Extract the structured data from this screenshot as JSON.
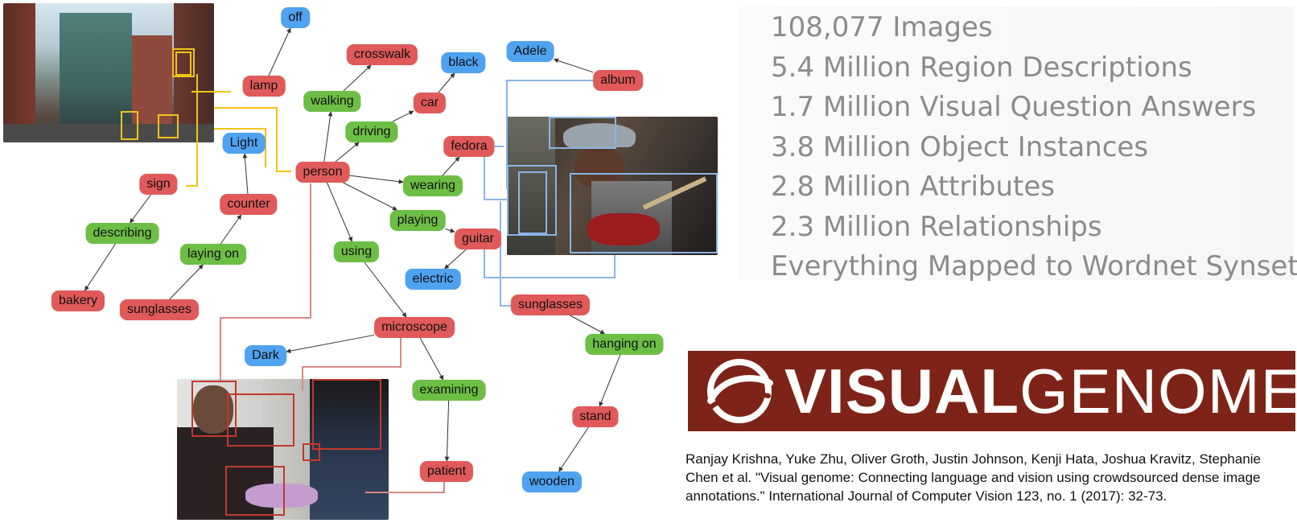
{
  "nodes": {
    "off": {
      "label": "off",
      "kind": "att"
    },
    "lamp": {
      "label": "lamp",
      "kind": "obj"
    },
    "crosswalk": {
      "label": "crosswalk",
      "kind": "obj"
    },
    "black": {
      "label": "black",
      "kind": "att"
    },
    "adele": {
      "label": "Adele",
      "kind": "att"
    },
    "album": {
      "label": "album",
      "kind": "obj"
    },
    "walking": {
      "label": "walking",
      "kind": "rel"
    },
    "car": {
      "label": "car",
      "kind": "obj"
    },
    "driving": {
      "label": "driving",
      "kind": "rel"
    },
    "fedora": {
      "label": "fedora",
      "kind": "obj"
    },
    "light": {
      "label": "Light",
      "kind": "att"
    },
    "person": {
      "label": "person",
      "kind": "obj"
    },
    "sign": {
      "label": "sign",
      "kind": "obj"
    },
    "wearing": {
      "label": "wearing",
      "kind": "rel"
    },
    "counter": {
      "label": "counter",
      "kind": "obj"
    },
    "playing": {
      "label": "playing",
      "kind": "rel"
    },
    "describing": {
      "label": "describing",
      "kind": "rel"
    },
    "guitar": {
      "label": "guitar",
      "kind": "obj"
    },
    "laying_on": {
      "label": "laying on",
      "kind": "rel"
    },
    "using": {
      "label": "using",
      "kind": "rel"
    },
    "electric": {
      "label": "electric",
      "kind": "att"
    },
    "bakery": {
      "label": "bakery",
      "kind": "obj"
    },
    "sunglasses1": {
      "label": "sunglasses",
      "kind": "obj"
    },
    "sunglasses2": {
      "label": "sunglasses",
      "kind": "obj"
    },
    "microscope": {
      "label": "microscope",
      "kind": "obj"
    },
    "hanging_on": {
      "label": "hanging on",
      "kind": "rel"
    },
    "dark": {
      "label": "Dark",
      "kind": "att"
    },
    "examining": {
      "label": "examining",
      "kind": "rel"
    },
    "stand": {
      "label": "stand",
      "kind": "obj"
    },
    "patient": {
      "label": "patient",
      "kind": "obj"
    },
    "wooden": {
      "label": "wooden",
      "kind": "att"
    }
  },
  "edges": [
    [
      "lamp",
      "off"
    ],
    [
      "walking",
      "crosswalk"
    ],
    [
      "driving",
      "car"
    ],
    [
      "car",
      "black"
    ],
    [
      "album",
      "adele"
    ],
    [
      "person",
      "walking"
    ],
    [
      "person",
      "driving"
    ],
    [
      "person",
      "wearing"
    ],
    [
      "person",
      "playing"
    ],
    [
      "person",
      "using"
    ],
    [
      "wearing",
      "fedora"
    ],
    [
      "playing",
      "guitar"
    ],
    [
      "guitar",
      "electric"
    ],
    [
      "using",
      "microscope"
    ],
    [
      "microscope",
      "dark"
    ],
    [
      "microscope",
      "examining"
    ],
    [
      "examining",
      "patient"
    ],
    [
      "counter",
      "light"
    ],
    [
      "sunglasses1",
      "laying_on"
    ],
    [
      "laying_on",
      "counter"
    ],
    [
      "sign",
      "describing"
    ],
    [
      "describing",
      "bakery"
    ],
    [
      "sunglasses2",
      "hanging_on"
    ],
    [
      "hanging_on",
      "stand"
    ],
    [
      "stand",
      "wooden"
    ]
  ],
  "stats": [
    "108,077 Images",
    "5.4 Million Region Descriptions",
    "1.7 Million Visual Question Answers",
    "3.8 Million Object Instances",
    "2.8 Million Attributes",
    "2.3 Million Relationships",
    "Everything Mapped to Wordnet Synsets"
  ],
  "logo": {
    "bold": "VISUAL",
    "light": "GENOME"
  },
  "citation": "Ranjay Krishna, Yuke Zhu, Oliver Groth, Justin Johnson, Kenji Hata, Joshua Kravitz, Stephanie Chen et al. \"Visual genome: Connecting language and vision using crowdsourced dense image annotations.\" International Journal of Computer Vision 123, no. 1 (2017): 32-73.",
  "colors": {
    "object": "#e05a59",
    "relationship": "#6dbe45",
    "attribute": "#4fa2ef",
    "street_box": "#f0c419",
    "concert_box": "#8ab4e6",
    "dentist_box": "#c0392b",
    "logo_bg": "#7e2317"
  }
}
